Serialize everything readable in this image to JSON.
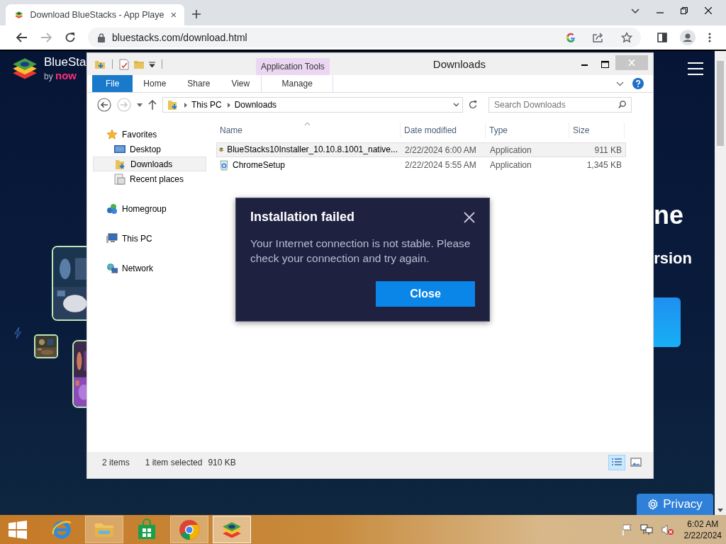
{
  "browser": {
    "tab": {
      "title": "Download BlueStacks - App Playe",
      "selected": true
    },
    "url": "bluestacks.com/download.html"
  },
  "web_page": {
    "logo": {
      "name": "BlueSta",
      "tagline_prefix": "by",
      "tagline_brand": "now"
    },
    "heading": "ne",
    "subheading": "rsion",
    "privacy_button": "Privacy"
  },
  "explorer": {
    "title": "Downloads",
    "contextual_group": "Application Tools",
    "ribbon_tabs": [
      {
        "label": "File",
        "kind": "file",
        "selected": false
      },
      {
        "label": "Home",
        "kind": "tab",
        "selected": false
      },
      {
        "label": "Share",
        "kind": "tab",
        "selected": false
      },
      {
        "label": "View",
        "kind": "tab",
        "selected": false
      },
      {
        "label": "Manage",
        "kind": "contextual",
        "selected": false
      }
    ],
    "breadcrumb": [
      "This PC",
      "Downloads"
    ],
    "search": {
      "placeholder": "Search Downloads"
    },
    "nav": [
      {
        "label": "Favorites",
        "kind": "favorites",
        "selected": false,
        "children": [
          {
            "label": "Desktop",
            "kind": "desktop",
            "selected": false
          },
          {
            "label": "Downloads",
            "kind": "downloads",
            "selected": true
          },
          {
            "label": "Recent places",
            "kind": "recent",
            "selected": false
          }
        ]
      },
      {
        "label": "Homegroup",
        "kind": "homegroup",
        "selected": false
      },
      {
        "label": "This PC",
        "kind": "pc",
        "selected": false
      },
      {
        "label": "Network",
        "kind": "network",
        "selected": false
      }
    ],
    "columns": [
      "Name",
      "Date modified",
      "Type",
      "Size"
    ],
    "files": [
      {
        "name": "BlueStacks10Installer_10.10.8.1001_native...",
        "date_modified": "2/22/2024 6:00 AM",
        "type": "Application",
        "size": "911 KB",
        "kind": "bluestacks",
        "selected": true
      },
      {
        "name": "ChromeSetup",
        "date_modified": "2/22/2024 5:55 AM",
        "type": "Application",
        "size": "1,345 KB",
        "kind": "chrome_setup",
        "selected": false
      }
    ],
    "status_bar": {
      "item_count": "2 items",
      "selection": "1 item selected",
      "selection_size": "910 KB"
    },
    "view_buttons": [
      {
        "kind": "details",
        "selected": true
      },
      {
        "kind": "large_icons",
        "selected": false
      }
    ]
  },
  "dialog": {
    "title": "Installation failed",
    "message": "Your Internet connection is not stable. Please check your connection and try again.",
    "button": "Close"
  },
  "taskbar": {
    "apps": [
      {
        "kind": "ie",
        "running": false,
        "selected": false
      },
      {
        "kind": "explorer",
        "running": true,
        "selected": false
      },
      {
        "kind": "store",
        "running": false,
        "selected": false
      },
      {
        "kind": "chrome",
        "running": true,
        "selected": false
      },
      {
        "kind": "bluestacks",
        "running": true,
        "selected": true
      }
    ],
    "time": "6:02 AM",
    "date": "2/22/2024"
  }
}
